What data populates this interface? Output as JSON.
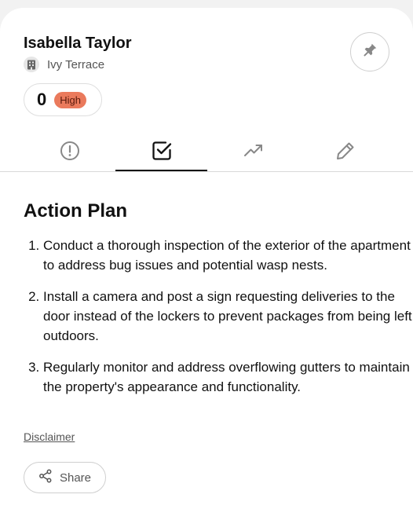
{
  "contact": {
    "name": "Isabella Taylor",
    "location": "Ivy Terrace",
    "location_icon": "building-icon",
    "score": "0",
    "priority": "High",
    "priority_color": "#ea7a5c"
  },
  "pin_icon": "pin-icon",
  "tabs": [
    {
      "icon": "alert-circle-icon",
      "active": false
    },
    {
      "icon": "checkbox-icon",
      "active": true
    },
    {
      "icon": "trending-up-icon",
      "active": false
    },
    {
      "icon": "pencil-icon",
      "active": false
    }
  ],
  "action_plan": {
    "heading": "Action Plan",
    "items": [
      "Conduct a thorough inspection of the exterior of the apartment to address bug issues and potential wasp nests.",
      "Install a camera and post a sign requesting deliveries to the door instead of the lockers to prevent packages from being left outdoors.",
      "Regularly monitor and address overflowing gutters to maintain the property's appearance and functionality."
    ]
  },
  "footer": {
    "disclaimer": "Disclaimer",
    "share_label": "Share",
    "share_icon": "share-icon"
  }
}
